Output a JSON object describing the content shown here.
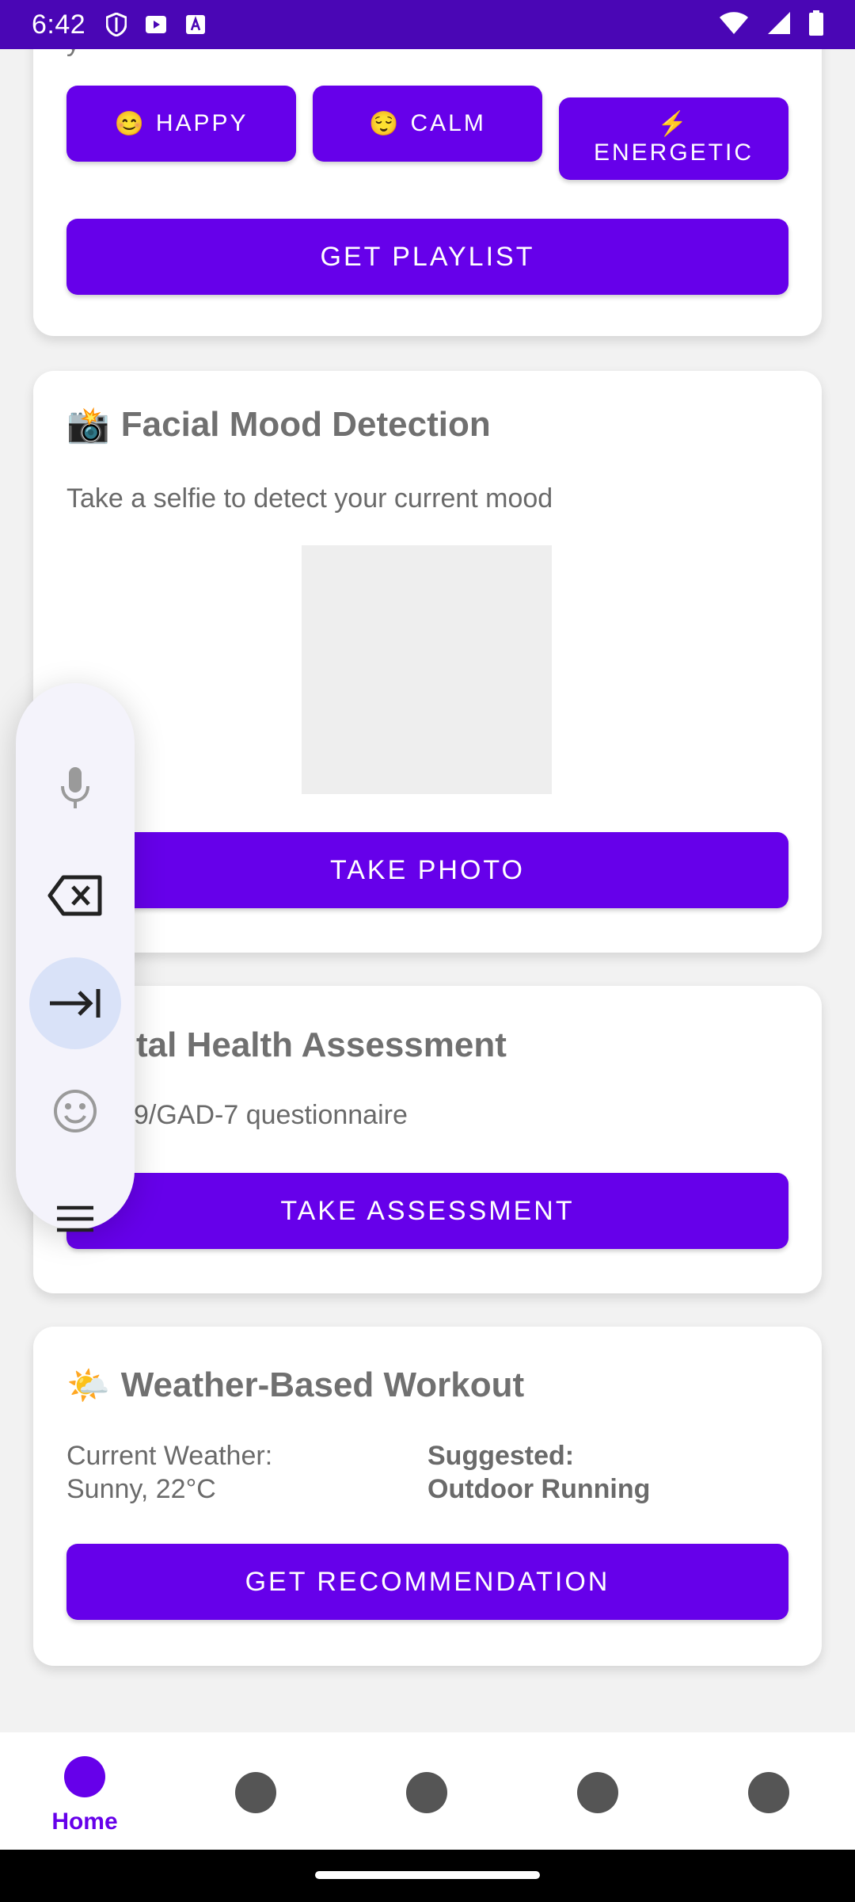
{
  "status_bar": {
    "time": "6:42",
    "icons": [
      "shield-icon",
      "play-store-icon",
      "a-box-icon",
      "wifi-icon",
      "signal-icon",
      "battery-icon"
    ]
  },
  "mood_card": {
    "partial_text": "y",
    "buttons": [
      {
        "emoji": "😊",
        "label": "HAPPY"
      },
      {
        "emoji": "😌",
        "label": "CALM"
      },
      {
        "emoji": "⚡",
        "label": "ENERGETIC"
      }
    ],
    "action": "GET PLAYLIST"
  },
  "facial_card": {
    "emoji": "📸",
    "title": "Facial Mood Detection",
    "description": "Take a selfie to detect your current mood",
    "action": "TAKE PHOTO"
  },
  "assessment_card": {
    "title": "Mental Health Assessment",
    "description": "PHQ-9/GAD-7 questionnaire",
    "action": "TAKE ASSESSMENT"
  },
  "weather_card": {
    "emoji": "🌤️",
    "title": "Weather-Based Workout",
    "weather_label": "Current Weather:",
    "weather_value": "Sunny, 22°C",
    "suggested_label": "Suggested:",
    "suggested_value": "Outdoor Running",
    "action": "GET RECOMMENDATION"
  },
  "keyboard_toolbar": {
    "items": [
      "microphone-icon",
      "backspace-icon",
      "tab-icon",
      "emoji-icon",
      "menu-icon"
    ],
    "active": "tab-icon"
  },
  "bottom_nav": {
    "items": [
      {
        "label": "Home",
        "active": true
      },
      {
        "label": "",
        "active": false
      },
      {
        "label": "",
        "active": false
      },
      {
        "label": "",
        "active": false
      },
      {
        "label": "",
        "active": false
      }
    ]
  },
  "colors": {
    "accent": "#6600EA",
    "status_bar": "#4A06B5",
    "card": "#FFFFFF",
    "background": "#F2F2F2",
    "title_text": "#707070"
  }
}
